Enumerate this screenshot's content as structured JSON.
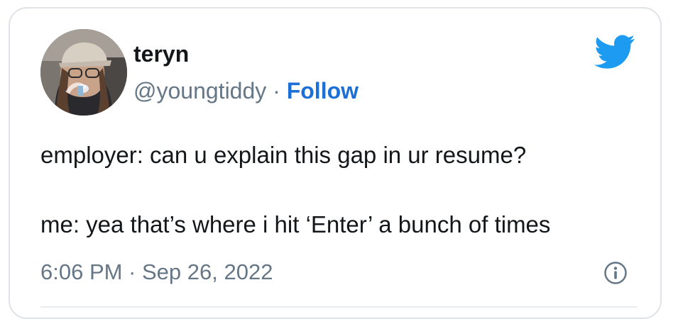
{
  "author": {
    "name": "teryn",
    "handle": "@youngtiddy",
    "separator": "·",
    "follow_label": "Follow"
  },
  "tweet": {
    "line1": "employer: can u explain this gap in ur resume?",
    "line2": "me: yea that’s where i hit ‘Enter’ a bunch of times"
  },
  "meta": {
    "timestamp": "6:06 PM · Sep 26, 2022"
  },
  "icons": {
    "brand": "twitter-bird-icon",
    "info": "info-icon"
  },
  "colors": {
    "twitter_blue": "#1d9bf0",
    "follow_blue": "#1b6fd6",
    "muted_gray": "#657786"
  }
}
